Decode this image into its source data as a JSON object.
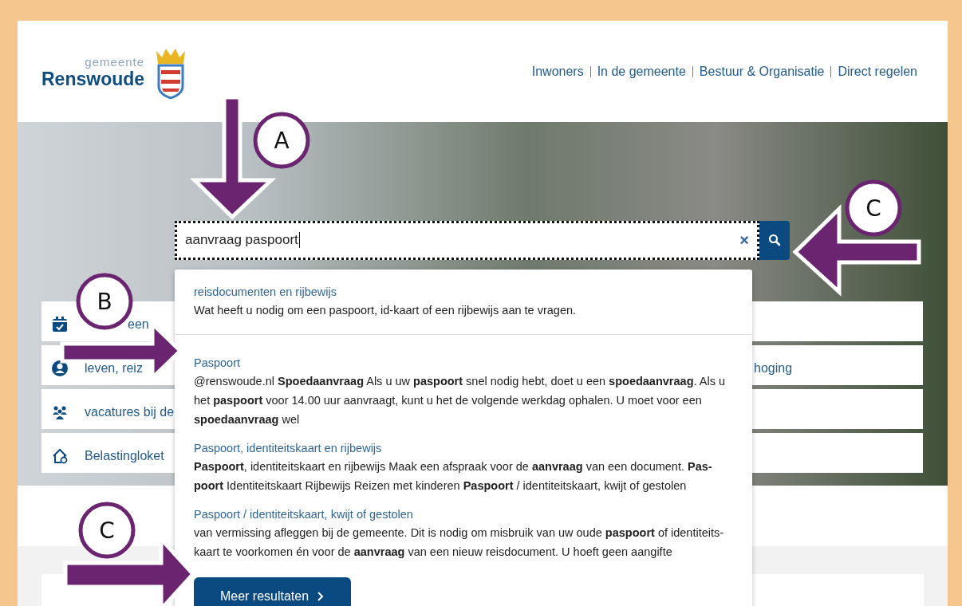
{
  "header": {
    "logo": {
      "small": "gemeente",
      "name": "Renswoude"
    },
    "nav": [
      {
        "label": "Inwoners"
      },
      {
        "label": "In de gemeente"
      },
      {
        "label": "Bestuur & Organisatie"
      },
      {
        "label": "Direct regelen"
      }
    ]
  },
  "quick_links": [
    {
      "kind": "calendar",
      "label": "een"
    },
    {
      "kind": "person",
      "label": "leven, reiz",
      "right": "hoging"
    },
    {
      "kind": "people",
      "label": "vacatures bij de"
    },
    {
      "kind": "house",
      "label": "Belastingloket"
    }
  ],
  "search": {
    "value": "aanvraag paspoort",
    "clear": "×"
  },
  "suggestions": [
    {
      "title": "reisdocumenten en rijbewijs",
      "snippet": "Wat heeft u nodig om een paspoort, id-kaart of een rijbewijs aan te vragen."
    },
    {
      "title": "Paspoort",
      "snippet": "@renswoude.nl **Spoedaanvraag** Als u uw **paspoort** snel nodig hebt, doet u een **spoedaanvraag**. Als u het **paspoort** voor 14.00 uur aanvraagt, kunt u het de volgende werkdag ophalen. U moet voor een **spoedaanvraag** wel"
    },
    {
      "title": "Paspoort, identiteitskaart en rijbewijs",
      "snippet": "**Paspoort**, identiteitskaart en rijbewijs Maak een afspraak voor de **aanvraag** van een document. **Pas-poort** Identiteitskaart Rijbewijs Reizen met kinderen **Paspoort** / identiteitskaart, kwijt of gestolen"
    },
    {
      "title": "Paspoort / identiteitskaart, kwijt of gestolen",
      "snippet": "van vermissing afleggen bij de gemeente. Dit is nodig om misbruik van uw oude **paspoort** of identiteits-kaart te voorkomen én voor de **aanvraag** van een nieuw reisdocument. U hoeft geen aangifte"
    }
  ],
  "more_button": "Meer resultaten",
  "annotations": [
    {
      "label": "A"
    },
    {
      "label": "B"
    },
    {
      "label": "C"
    },
    {
      "label": "C"
    }
  ]
}
